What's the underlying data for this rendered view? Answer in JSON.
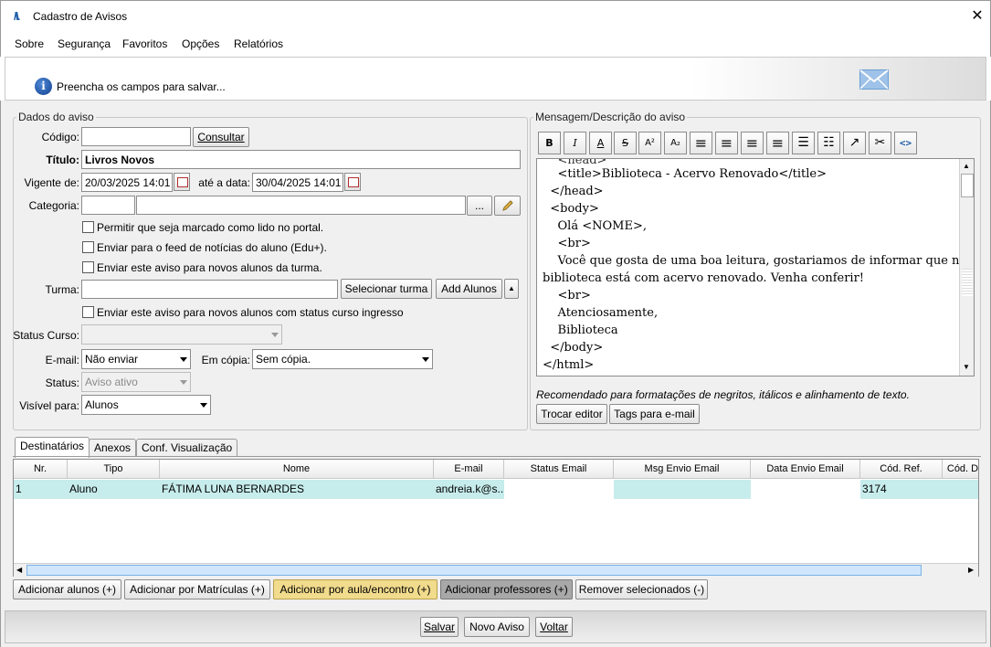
{
  "window": {
    "title": "Cadastro de Avisos",
    "close_glyph": "✕",
    "logo_text": "/\\\\."
  },
  "menu": [
    "Sobre",
    "Segurança",
    "Favoritos",
    "Opções",
    "Relatórios"
  ],
  "banner": {
    "message": "Preencha os campos para salvar...",
    "info_glyph": "i",
    "icon": "envelope-icon"
  },
  "dados": {
    "legend": "Dados do aviso",
    "codigo_label": "Código:",
    "codigo_value": "",
    "consultar": "Consultar",
    "titulo_label": "Título:",
    "titulo_value": "Livros Novos",
    "vigente_label": "Vigente de:",
    "vigente_value": "20/03/2025 14:01",
    "ate_label": "até a data:",
    "ate_value": "30/04/2025 14:01",
    "categoria_label": "Categoria:",
    "categoria_code": "",
    "categoria_value": "",
    "ellipsis": "...",
    "check1": "Permitir que seja marcado como lido no portal.",
    "check2": "Enviar para o feed de notícias do aluno (Edu+).",
    "check3": "Enviar este aviso para novos alunos da turma.",
    "turma_label": "Turma:",
    "turma_value": "",
    "selecionar_turma": "Selecionar turma",
    "add_alunos": "Add Alunos",
    "check4": "Enviar este aviso para novos alunos com status curso ingresso",
    "status_curso_label": "Status Curso:",
    "status_curso_value": "",
    "email_label": "E-mail:",
    "email_value": "Não enviar",
    "copia_label": "Em cópia:",
    "copia_value": "Sem cópia.",
    "status_label": "Status:",
    "status_value": "Aviso ativo",
    "visivel_label": "Visível para:",
    "visivel_value": "Alunos"
  },
  "mensagem": {
    "legend": "Mensagem/Descrição do aviso",
    "toolbar": [
      "B",
      "I",
      "A",
      "S",
      "A²",
      "A₂",
      "≡",
      "≡",
      "≡",
      "≡",
      "☰",
      "☷",
      "↗",
      "✂",
      "<>"
    ],
    "lines": [
      "    <title>Biblioteca - Acervo Renovado</title>",
      "  </head>",
      "  <body>",
      "    Olá <NOME>,",
      "    <br>",
      "    Você que gosta de uma boa leitura, gostariamos de informar que nossa",
      "biblioteca está com acervo renovado. Venha conferir!",
      "    <br>",
      "    Atenciosamente,",
      "    Biblioteca",
      "  </body>",
      "</html>"
    ],
    "hint": "Recomendado para formatações de negritos, itálicos e alinhamento de texto.",
    "trocar_editor": "Trocar editor",
    "tags_email": "Tags para e-mail"
  },
  "tabs": [
    "Destinatários",
    "Anexos",
    "Conf. Visualização"
  ],
  "grid": {
    "columns": [
      "Nr.",
      "Tipo",
      "Nome",
      "E-mail",
      "Status Email",
      "Msg Envio Email",
      "Data Envio Email",
      "Cód. Ref.",
      "Cód. D"
    ],
    "rows": [
      [
        "1",
        "Aluno",
        "FÁTIMA LUNA BERNARDES",
        "andreia.k@s...",
        "",
        "",
        "",
        "3174",
        ""
      ]
    ]
  },
  "actions": [
    "Adicionar alunos (+)",
    "Adicionar por Matrículas (+)",
    "Adicionar por aula/encontro (+)",
    "Adicionar professores (+)",
    "Remover selecionados (-)"
  ],
  "footer": {
    "salvar": "Salvar",
    "novo": "Novo Aviso",
    "voltar": "Voltar"
  },
  "colors": {
    "accent_yellow": "#f1db8c",
    "accent_gray": "#a8a8a8",
    "row_highlight": "#c7ecec"
  }
}
